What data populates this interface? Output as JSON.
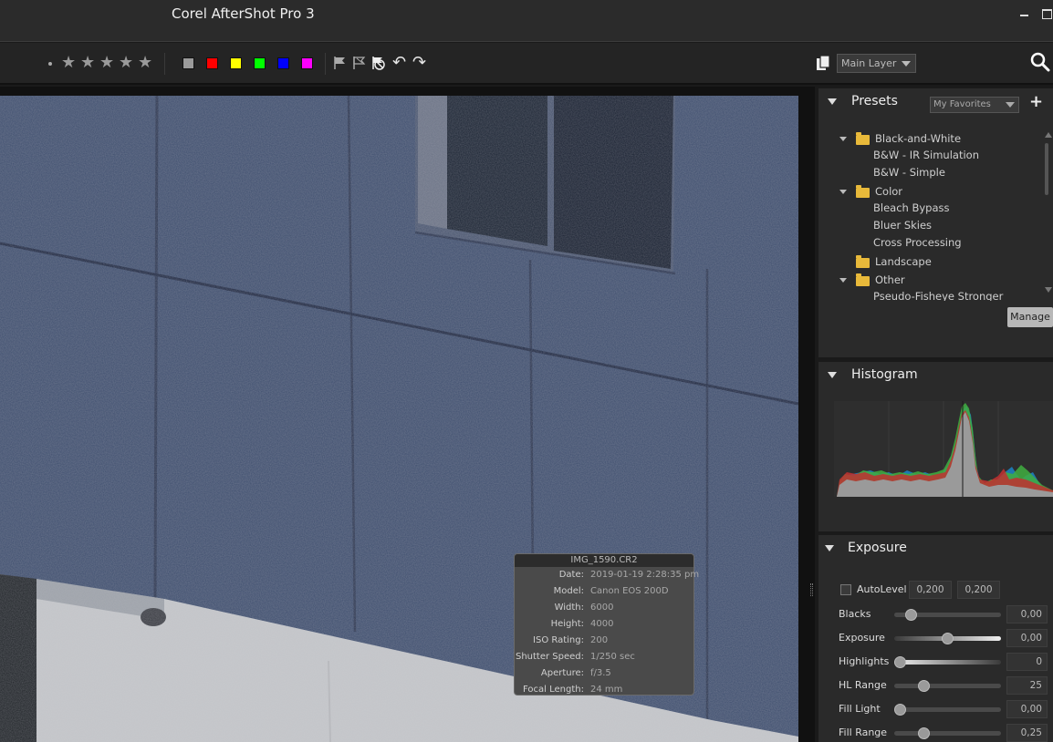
{
  "app": {
    "title": "Corel AfterShot Pro 3"
  },
  "toolbar": {
    "rating_stars": 5,
    "color_labels": [
      "#9a9a9a",
      "#ff0000",
      "#ffff00",
      "#00ff00",
      "#0000ff",
      "#ff00ff"
    ],
    "layer_select": "Main Layer"
  },
  "info": {
    "filename": "IMG_1590.CR2",
    "rows": [
      {
        "key": "Date:",
        "value": "2019-01-19 2:28:35 pm"
      },
      {
        "key": "Model:",
        "value": "Canon EOS 200D"
      },
      {
        "key": "Width:",
        "value": "6000"
      },
      {
        "key": "Height:",
        "value": "4000"
      },
      {
        "key": "ISO Rating:",
        "value": "200"
      },
      {
        "key": "Shutter Speed:",
        "value": "1/250 sec"
      },
      {
        "key": "Aperture:",
        "value": "f/3.5"
      },
      {
        "key": "Focal Length:",
        "value": "24 mm"
      }
    ]
  },
  "presets": {
    "title": "Presets",
    "favorites_select": "My Favorites",
    "items": [
      {
        "label": "Black-and-White",
        "type": "folder"
      },
      {
        "label": "B&W - IR Simulation",
        "type": "item"
      },
      {
        "label": "B&W - Simple",
        "type": "item"
      },
      {
        "label": "Color",
        "type": "folder"
      },
      {
        "label": "Bleach Bypass",
        "type": "item"
      },
      {
        "label": "Bluer Skies",
        "type": "item"
      },
      {
        "label": "Cross Processing",
        "type": "item"
      },
      {
        "label": "Landscape",
        "type": "folder-collapsed"
      },
      {
        "label": "Other",
        "type": "folder"
      },
      {
        "label": "Pseudo-Fisheye Stronger",
        "type": "item"
      }
    ],
    "manage_label": "Manage"
  },
  "histogram": {
    "title": "Histogram"
  },
  "exposure": {
    "title": "Exposure",
    "autolevel_label": "AutoLevel",
    "autolevel_values": [
      "0,200",
      "0,200"
    ],
    "sliders": [
      {
        "label": "Blacks",
        "value": "0,00",
        "level": 0.12
      },
      {
        "label": "Exposure",
        "value": "0,00",
        "level": 0.5
      },
      {
        "label": "Highlights",
        "value": "0",
        "level": 0.0
      },
      {
        "label": "HL Range",
        "value": "25",
        "level": 0.25
      },
      {
        "label": "Fill Light",
        "value": "0,00",
        "level": 0.0
      },
      {
        "label": "Fill Range",
        "value": "0,25",
        "level": 0.25
      }
    ]
  }
}
